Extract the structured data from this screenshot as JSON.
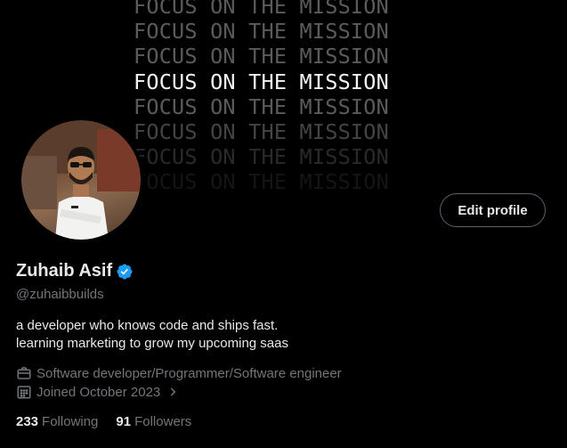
{
  "banner": {
    "lines": [
      "FOCUS ON THE MISSION",
      "FOCUS ON THE MISSION",
      "FOCUS ON THE MISSION",
      "FOCUS ON THE MISSION",
      "FOCUS ON THE MISSION",
      "FOCUS ON THE MISSION",
      "FOCUS ON THE MISSION",
      "FOCUS ON THE MISSION"
    ]
  },
  "profile": {
    "edit_label": "Edit profile",
    "name": "Zuhaib Asif",
    "handle": "@zuhaibbuilds",
    "bio_line1": "a developer who knows code and ships fast.",
    "bio_line2": "learning marketing to grow my upcoming saas",
    "profession": "Software developer/Programmer/Software engineer",
    "joined": "Joined October 2023",
    "following_count": "233",
    "following_label": "Following",
    "followers_count": "91",
    "followers_label": "Followers"
  },
  "icons": {
    "verified": "verified-badge-icon",
    "profession": "briefcase-icon",
    "joined": "calendar-icon",
    "chevron": "chevron-right-icon"
  },
  "colors": {
    "background": "#000000",
    "text_primary": "#e7e9ea",
    "text_secondary": "#71767b",
    "verified_blue": "#1d9bf0",
    "button_border": "#536471"
  }
}
